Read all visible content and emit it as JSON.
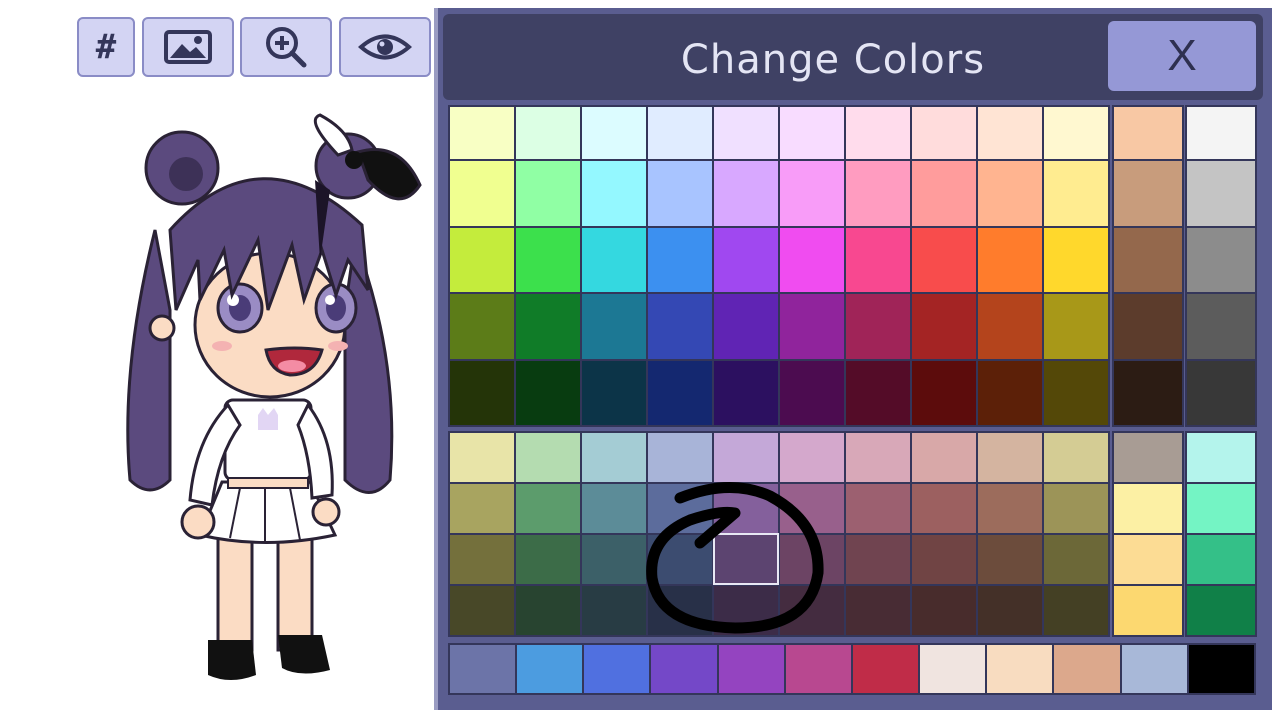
{
  "toolbar": {
    "hash_label": "#",
    "icons": [
      "hash-icon",
      "background-image-icon",
      "zoom-in-icon",
      "eye-icon"
    ]
  },
  "dialog": {
    "title": "Change Colors",
    "close_label": "X"
  },
  "palette": {
    "bright": [
      [
        "#f8ffc4",
        "#dcffe4",
        "#dcfcff",
        "#e0ecff",
        "#f0e0ff",
        "#f8dcff",
        "#ffdcec",
        "#ffdcdc",
        "#ffe4d4",
        "#fff8d0"
      ],
      [
        "#f0ff90",
        "#90ffa4",
        "#94f8ff",
        "#a8c4ff",
        "#d8a8ff",
        "#f89cf8",
        "#ff9cc0",
        "#ff9c9c",
        "#ffb490",
        "#ffec90"
      ],
      [
        "#c4ec3c",
        "#3ce04c",
        "#34d8e0",
        "#3c90f0",
        "#a048f0",
        "#f04cf0",
        "#f84890",
        "#f84c4c",
        "#ff7c2c",
        "#ffd82c"
      ],
      [
        "#5c7c18",
        "#107c28",
        "#1c7894",
        "#3448b4",
        "#6024b4",
        "#90249c",
        "#a02458",
        "#a42424",
        "#b4441c",
        "#a89818"
      ],
      [
        "#243408",
        "#083c10",
        "#0c3448",
        "#142870",
        "#2c1060",
        "#4c0c50",
        "#540c28",
        "#5c0c0c",
        "#5c2008",
        "#544808"
      ]
    ],
    "skin": [
      "#f8c8a4",
      "#c89c7c",
      "#94684c",
      "#5c3c2c",
      "#2c1c14"
    ],
    "grays": [
      "#f4f4f4",
      "#c4c4c4",
      "#8c8c8c",
      "#5c5c5c",
      "#383838"
    ],
    "muted": [
      [
        "#e8e4a8",
        "#b4dcb0",
        "#a4ccd4",
        "#a8b4d8",
        "#c4a8d8",
        "#d4a8cc",
        "#d8a8b8",
        "#d8a8a8",
        "#d4b4a0",
        "#d4cc94"
      ],
      [
        "#a8a460",
        "#5c9c6c",
        "#5c8c98",
        "#5c6c9c",
        "#84609c",
        "#98608c",
        "#9c6070",
        "#9c6060",
        "#9c6c5c",
        "#9c9458"
      ],
      [
        "#74703c",
        "#3c6c48",
        "#3c6068",
        "#3c4c70",
        "#5c4470",
        "#6c4464",
        "#704450",
        "#704444",
        "#6c4c3c",
        "#6c6838"
      ],
      [
        "#484828",
        "#284430",
        "#283c44",
        "#283048",
        "#3c2c48",
        "#442c40",
        "#482c34",
        "#482c2c",
        "#443028",
        "#444024"
      ]
    ],
    "tan": [
      "#a89c94",
      "#fcf0a4",
      "#fcdc94",
      "#fcd870"
    ],
    "mint": [
      "#b4f4ec",
      "#74f4c4",
      "#34c088",
      "#108048"
    ],
    "recent": [
      "#6c74a8",
      "#4c9ce0",
      "#5070e0",
      "#7448c8",
      "#9444c0",
      "#b84890",
      "#c02c48",
      "#f0e4e0",
      "#f8dcc0",
      "#dca88c",
      "#a8b8d8",
      "#000000"
    ]
  }
}
